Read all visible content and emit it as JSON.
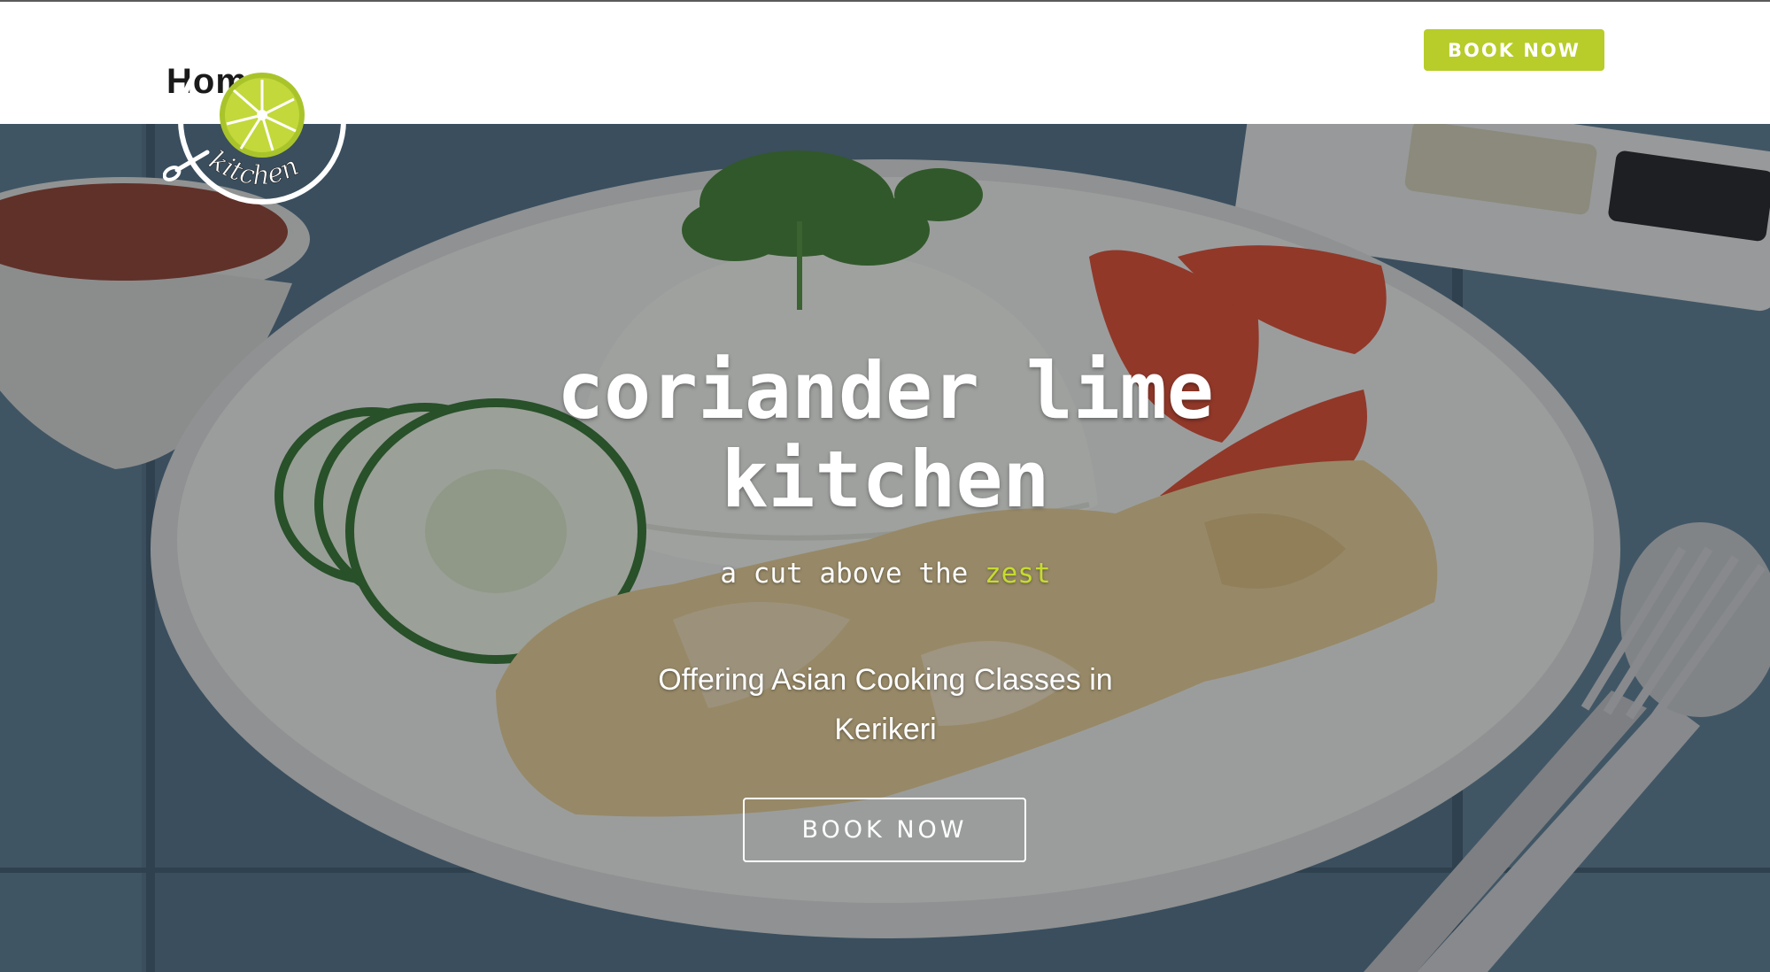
{
  "header": {
    "nav_home": "Home",
    "book_button": "BOOK NOW"
  },
  "logo": {
    "text": "kitchen",
    "icon": "lime-slice-icon"
  },
  "hero": {
    "title_line1": "coriander lime",
    "title_line2": "kitchen",
    "tagline_prefix": "a cut above the ",
    "tagline_accent": "zest",
    "subtitle_line1": "Offering Asian Cooking Classes in",
    "subtitle_line2": "Kerikeri",
    "book_button": "BOOK NOW"
  },
  "colors": {
    "accent": "#b8cc2a",
    "accent_text": "#c6dc2e"
  }
}
